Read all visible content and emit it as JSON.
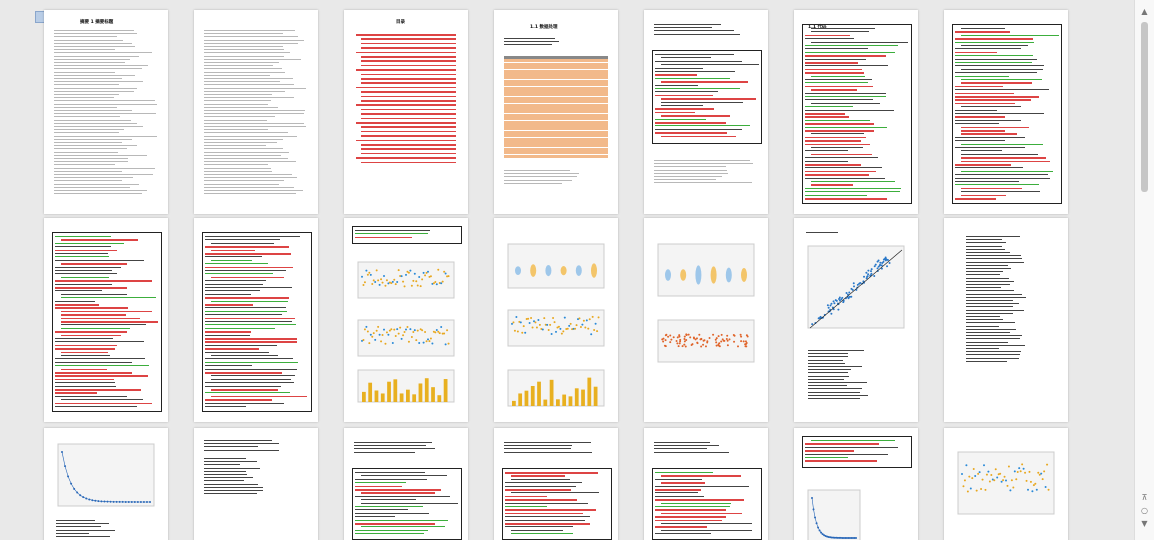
{
  "document": {
    "pages": [
      {
        "title": "摘要 1 摘要标题",
        "number": ""
      },
      {
        "title": "",
        "number": ""
      },
      {
        "title": "目录",
        "number": ""
      },
      {
        "title": "1.1 数据处理",
        "number": ""
      },
      {
        "title": "",
        "number": ""
      },
      {
        "title": "1.1 代码",
        "number": ""
      },
      {
        "title": "",
        "number": ""
      }
    ],
    "scrollbar": {
      "up_glyph": "▲",
      "down_glyph": "▼"
    }
  }
}
